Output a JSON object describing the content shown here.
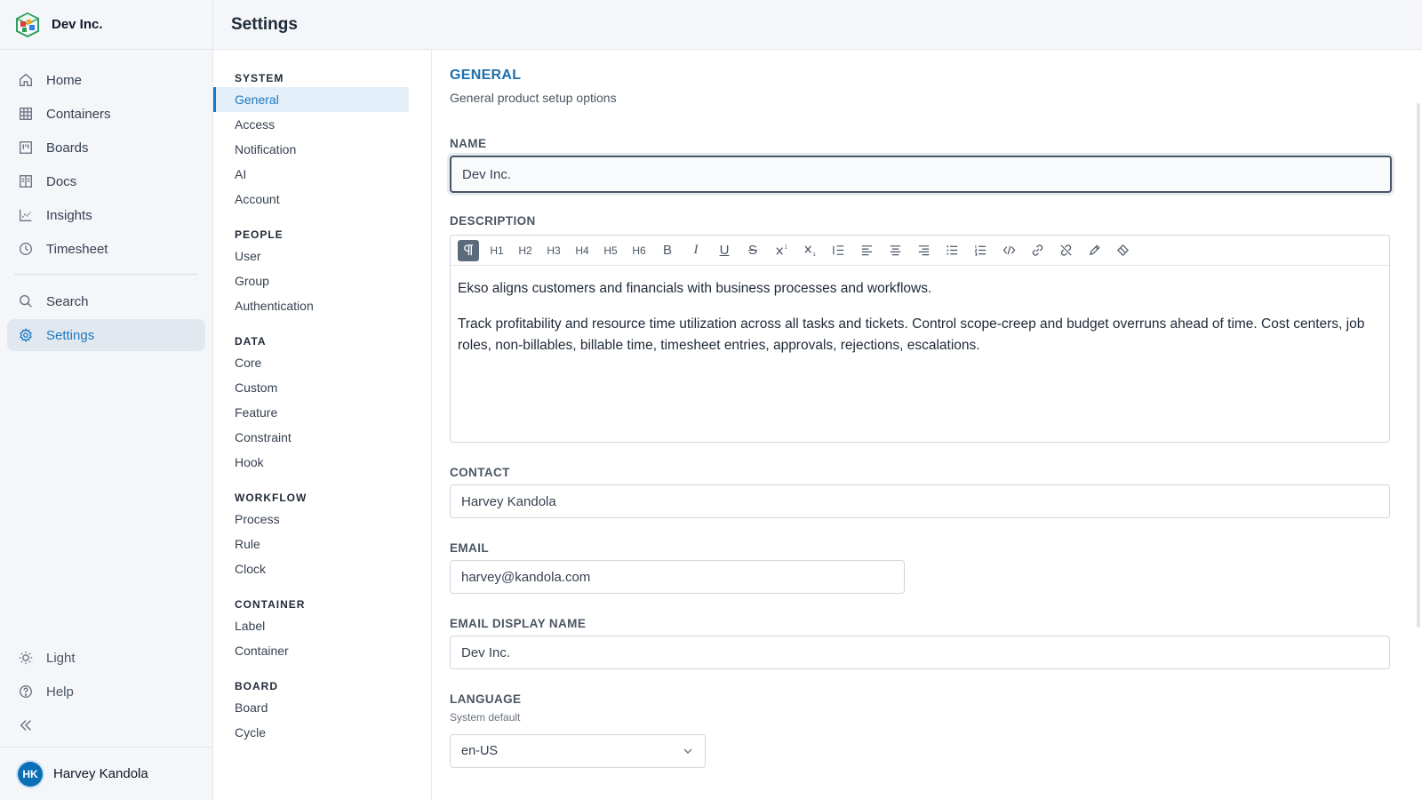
{
  "brand": {
    "name": "Dev Inc."
  },
  "nav": {
    "items": [
      {
        "label": "Home",
        "icon": "home-icon"
      },
      {
        "label": "Containers",
        "icon": "grid-icon"
      },
      {
        "label": "Boards",
        "icon": "board-icon"
      },
      {
        "label": "Docs",
        "icon": "book-icon"
      },
      {
        "label": "Insights",
        "icon": "chart-icon"
      },
      {
        "label": "Timesheet",
        "icon": "clock-icon"
      },
      {
        "label": "Search",
        "icon": "search-icon"
      },
      {
        "label": "Settings",
        "icon": "gear-icon",
        "active": true
      }
    ],
    "bottom": [
      {
        "label": "Light",
        "icon": "sun-icon"
      },
      {
        "label": "Help",
        "icon": "help-icon"
      }
    ]
  },
  "user": {
    "initials": "HK",
    "name": "Harvey Kandola"
  },
  "header": {
    "title": "Settings"
  },
  "settings_nav": {
    "system": {
      "title": "SYSTEM",
      "items": [
        "General",
        "Access",
        "Notification",
        "AI",
        "Account"
      ]
    },
    "people": {
      "title": "PEOPLE",
      "items": [
        "User",
        "Group",
        "Authentication"
      ]
    },
    "data": {
      "title": "DATA",
      "items": [
        "Core",
        "Custom",
        "Feature",
        "Constraint",
        "Hook"
      ]
    },
    "workflow": {
      "title": "WORKFLOW",
      "items": [
        "Process",
        "Rule",
        "Clock"
      ]
    },
    "container": {
      "title": "CONTAINER",
      "items": [
        "Label",
        "Container"
      ]
    },
    "board": {
      "title": "BOARD",
      "items": [
        "Board",
        "Cycle"
      ]
    }
  },
  "general": {
    "title": "GENERAL",
    "subtitle": "General product setup options",
    "name_label": "NAME",
    "name_value": "Dev Inc.",
    "description_label": "DESCRIPTION",
    "toolbar": {
      "h1": "H1",
      "h2": "H2",
      "h3": "H3",
      "h4": "H4",
      "h5": "H5",
      "h6": "H6",
      "bold": "B",
      "italic": "I",
      "underline": "U",
      "strike": "S"
    },
    "description_p1": "Ekso aligns customers and financials with business processes and workflows.",
    "description_p2": "Track profitability and resource time utilization across all tasks and tickets. Control scope-creep and budget overruns ahead of time. Cost centers, job roles, non-billables, billable time, timesheet entries, approvals, rejections, escalations.",
    "contact_label": "CONTACT",
    "contact_value": "Harvey Kandola",
    "email_label": "EMAIL",
    "email_value": "harvey@kandola.com",
    "email_display_label": "EMAIL DISPLAY NAME",
    "email_display_value": "Dev Inc.",
    "language_label": "LANGUAGE",
    "language_hint": "System default",
    "language_value": "en-US"
  },
  "colors": {
    "accent": "#1d78c1",
    "sidebar_bg": "#f4f6f9",
    "active_bg": "#e3f0fa"
  }
}
